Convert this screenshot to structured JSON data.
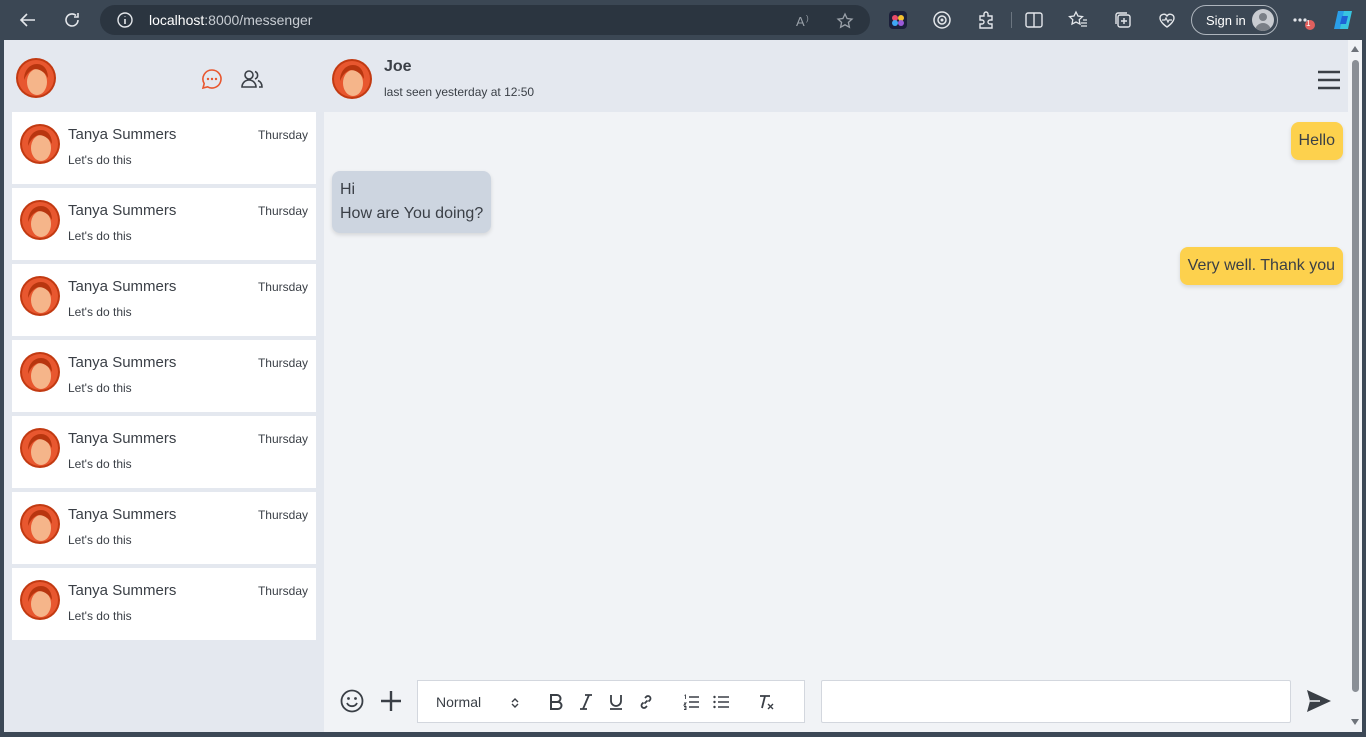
{
  "browser": {
    "url_host": "localhost",
    "url_path": ":8000/messenger",
    "sign_in_label": "Sign in",
    "notification_count": "1"
  },
  "sidebar": {
    "conversations": [
      {
        "name": "Tanya Summers",
        "date": "Thursday",
        "preview": "Let's do this"
      },
      {
        "name": "Tanya Summers",
        "date": "Thursday",
        "preview": "Let's do this"
      },
      {
        "name": "Tanya Summers",
        "date": "Thursday",
        "preview": "Let's do this"
      },
      {
        "name": "Tanya Summers",
        "date": "Thursday",
        "preview": "Let's do this"
      },
      {
        "name": "Tanya Summers",
        "date": "Thursday",
        "preview": "Let's do this"
      },
      {
        "name": "Tanya Summers",
        "date": "Thursday",
        "preview": "Let's do this"
      },
      {
        "name": "Tanya Summers",
        "date": "Thursday",
        "preview": "Let's do this"
      }
    ]
  },
  "chat": {
    "contact_name": "Joe",
    "status": "last seen yesterday at 12:50",
    "messages": [
      {
        "direction": "sent",
        "text": "Hello"
      },
      {
        "direction": "received",
        "text": "Hi\nHow are You doing?"
      },
      {
        "direction": "sent",
        "text": "Very well. Thank you"
      }
    ]
  },
  "composer": {
    "format_value": "Normal",
    "input_value": ""
  },
  "colors": {
    "accent": "#e8572f",
    "sent_bubble": "#fdd14d",
    "received_bubble": "#cdd5e0"
  }
}
